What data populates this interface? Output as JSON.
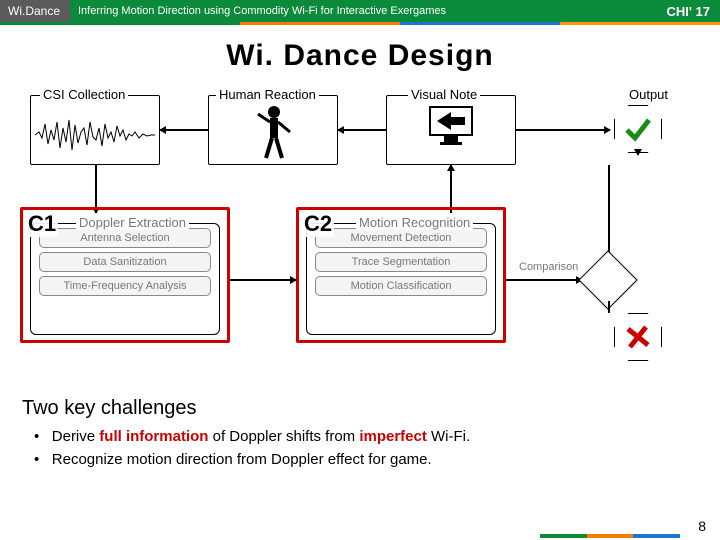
{
  "topbar": {
    "left": "Wi.Dance",
    "mid": "Inferring Motion Direction using Commodity Wi-Fi for Interactive Exergames",
    "right": "CHI' 17"
  },
  "title": "Wi. Dance  Design",
  "stages": {
    "csi": "CSI Collection",
    "human": "Human Reaction",
    "visual": "Visual Note",
    "output": "Output",
    "comparison": "Comparison"
  },
  "doppler": {
    "title": "Doppler Extraction",
    "items": [
      "Antenna Selection",
      "Data Sanitization",
      "Time-Frequency Analysis"
    ]
  },
  "motion": {
    "title": "Motion Recognition",
    "items": [
      "Movement Detection",
      "Trace Segmentation",
      "Motion Classification"
    ]
  },
  "c1": "C1",
  "c2": "C2",
  "subheading": "Two  key  challenges",
  "bullet1a": "Derive ",
  "bullet1b": "full  information",
  "bullet1c": "  of Doppler shifts from ",
  "bullet1d": "imperfect",
  "bullet1e": "  Wi-Fi.",
  "bullet2": "Recognize motion direction from Doppler effect for game.",
  "pagenum": "8"
}
